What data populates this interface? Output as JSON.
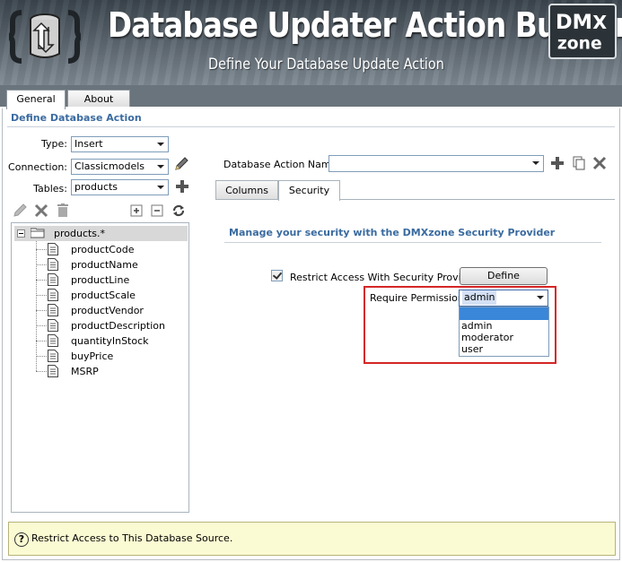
{
  "header": {
    "title": "Database Updater Action Builder",
    "subtitle": "Define Your Database Update Action",
    "logo_icon": "database-update-icon",
    "brand_logo": "dmxzone-logo"
  },
  "main_tabs": [
    {
      "label": "General",
      "active": true
    },
    {
      "label": "About",
      "active": false
    }
  ],
  "section_title": "Define Database Action",
  "form": {
    "type_label": "Type:",
    "type_value": "Insert",
    "connection_label": "Connection:",
    "connection_value": "Classicmodels",
    "tables_label": "Tables:",
    "tables_value": "products"
  },
  "tree": {
    "root": "products.*",
    "items": [
      "productCode",
      "productName",
      "productLine",
      "productScale",
      "productVendor",
      "productDescription",
      "quantityInStock",
      "buyPrice",
      "MSRP"
    ]
  },
  "action_name": {
    "label": "Database Action Name:",
    "value": ""
  },
  "inner_tabs": [
    {
      "label": "Columns",
      "active": false
    },
    {
      "label": "Security",
      "active": true
    }
  ],
  "security": {
    "title": "Manage your security with the DMXzone Security Provider",
    "restrict_label": "Restrict Access With Security Provider",
    "restrict_checked": true,
    "define_button": "Define",
    "permission_label": "Require Permission:",
    "permission_value": "admin",
    "permission_options": [
      "admin",
      "moderator",
      "user"
    ]
  },
  "help": {
    "text": "Restrict Access to This Database Source."
  },
  "colors": {
    "accent_title": "#3a6ba0",
    "highlight": "#d42626",
    "help_bg": "#fbfbd3"
  }
}
